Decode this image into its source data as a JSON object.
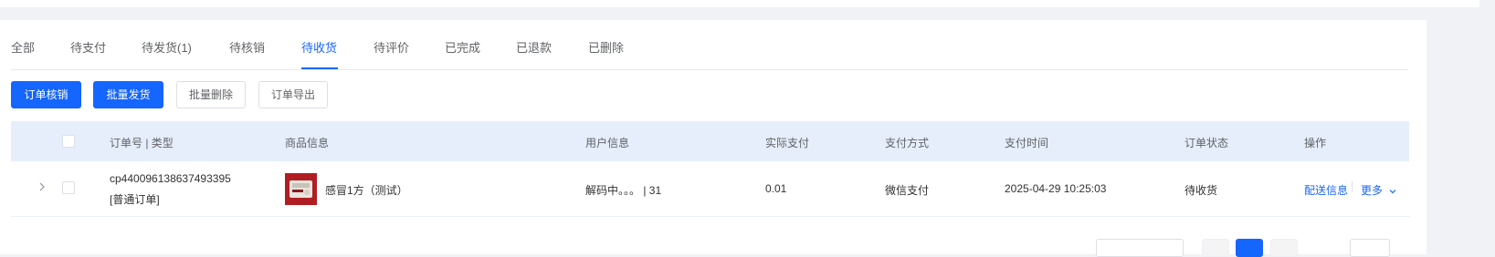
{
  "tabs": [
    {
      "label": "全部"
    },
    {
      "label": "待支付"
    },
    {
      "label": "待发货(1)"
    },
    {
      "label": "待核销"
    },
    {
      "label": "待收货"
    },
    {
      "label": "待评价"
    },
    {
      "label": "已完成"
    },
    {
      "label": "已退款"
    },
    {
      "label": "已删除"
    }
  ],
  "active_tab": "待收货",
  "toolbar": {
    "verify_label": "订单核销",
    "batch_ship_label": "批量发货",
    "batch_delete_label": "批量删除",
    "export_label": "订单导出"
  },
  "table": {
    "headers": {
      "order_no": "订单号 | 类型",
      "product": "商品信息",
      "user": "用户信息",
      "paid": "实际支付",
      "pay_method": "支付方式",
      "pay_time": "支付时间",
      "status": "订单状态",
      "actions": "操作"
    },
    "rows": [
      {
        "order_no": "cp440096138637493395",
        "order_type": "[普通订单]",
        "product_name": "感冒1方（测试）",
        "user": "解码中。。。 | 31",
        "paid": "0.01",
        "pay_method": "微信支付",
        "pay_time": "2025-04-29 10:25:03",
        "status": "待收货",
        "action_delivery": "配送信息",
        "action_more": "更多"
      }
    ]
  },
  "colors": {
    "primary": "#1565ff",
    "header_bg": "#e6eefc",
    "page_bg": "#f0f2f5"
  },
  "icons": {
    "expand": "chevron-right-icon",
    "more": "chevron-down-icon"
  }
}
